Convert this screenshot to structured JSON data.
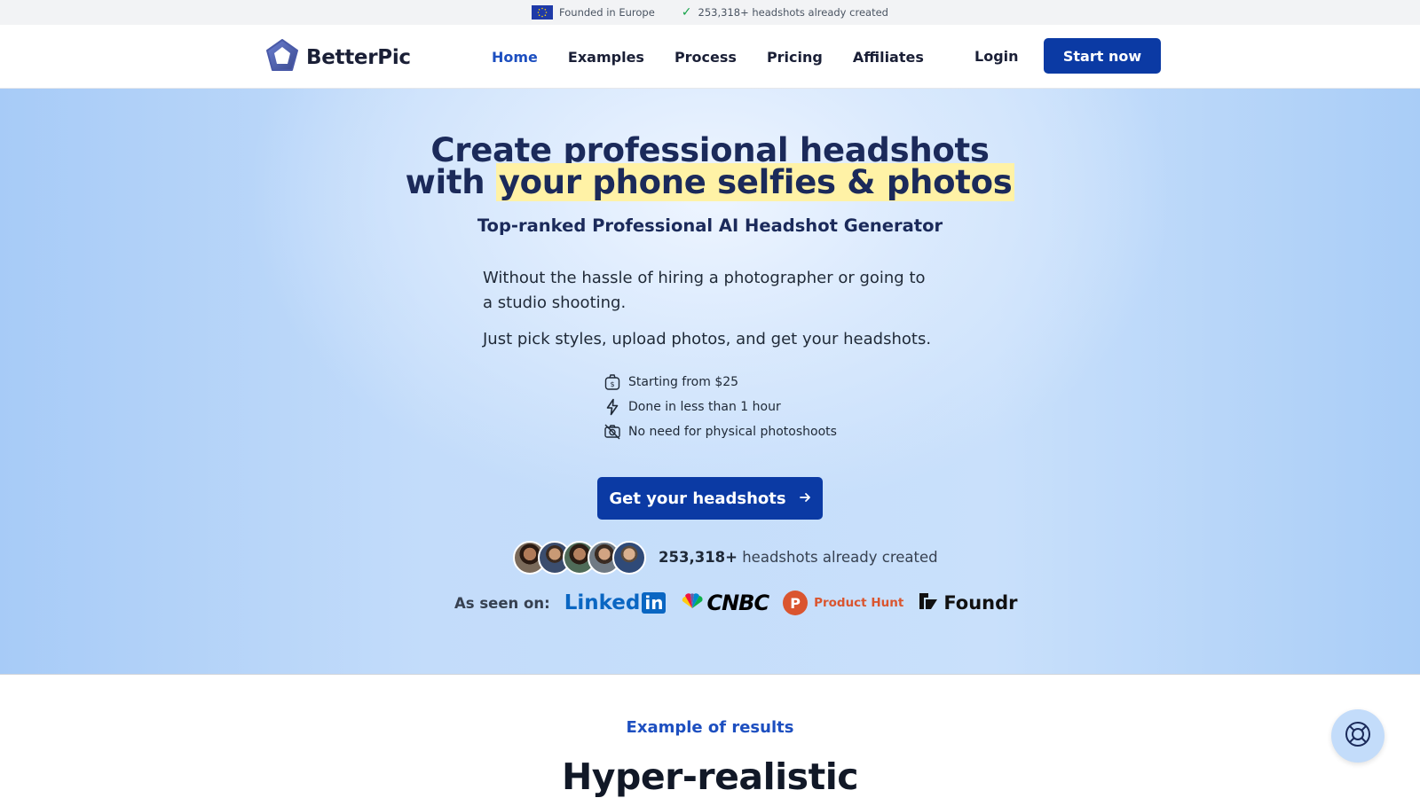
{
  "topbar": {
    "founded": "Founded in Europe",
    "created": "253,318+ headshots already created"
  },
  "nav": {
    "brand": "BetterPic",
    "items": [
      {
        "label": "Home",
        "active": true
      },
      {
        "label": "Examples"
      },
      {
        "label": "Process"
      },
      {
        "label": "Pricing"
      },
      {
        "label": "Affiliates"
      }
    ],
    "login": "Login",
    "start": "Start now"
  },
  "hero": {
    "title_line1_plain": "Create ",
    "title_line1_underlined": "professional headshots",
    "title_line2_plain": "with ",
    "title_line2_highlight": "your phone selfies & photos",
    "subtitle": "Top-ranked Professional AI Headshot Generator",
    "desc1": "Without the hassle of hiring a photographer or going to a studio shooting.",
    "desc2": "Just pick styles, upload photos, and get your headshots.",
    "features": [
      {
        "icon": "money-bag-icon",
        "label": "Starting from $25"
      },
      {
        "icon": "lightning-icon",
        "label": "Done in less than 1 hour"
      },
      {
        "icon": "camera-off-icon",
        "label": "No need for physical photoshoots"
      }
    ],
    "cta": "Get your headshots",
    "count_number": "253,318+",
    "count_text": " headshots already created",
    "seen_label": "As seen on:",
    "press": {
      "linkedin": "Linked",
      "linkedin_in": "in",
      "cnbc": "CNBC",
      "producthunt_letter": "P",
      "producthunt": "Product Hunt",
      "foundr": "Foundr"
    }
  },
  "results": {
    "label": "Example of results",
    "title": "Hyper-realistic"
  },
  "colors": {
    "accent": "#0b3aa4",
    "link_active": "#1d4fc0",
    "highlight": "#fff2a6"
  }
}
